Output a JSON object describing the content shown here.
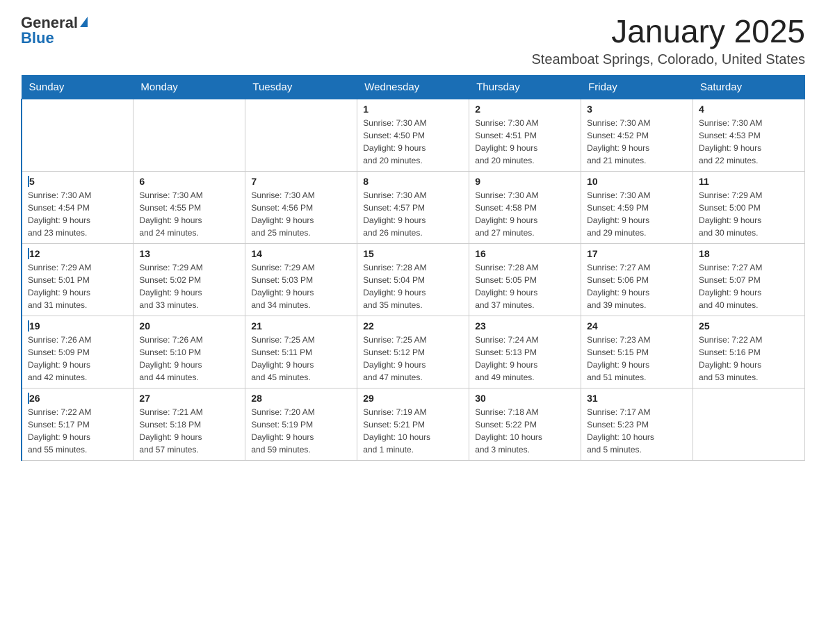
{
  "header": {
    "logo_general": "General",
    "logo_blue": "Blue",
    "month_year": "January 2025",
    "location": "Steamboat Springs, Colorado, United States"
  },
  "days_of_week": [
    "Sunday",
    "Monday",
    "Tuesday",
    "Wednesday",
    "Thursday",
    "Friday",
    "Saturday"
  ],
  "weeks": [
    [
      {
        "num": "",
        "info": ""
      },
      {
        "num": "",
        "info": ""
      },
      {
        "num": "",
        "info": ""
      },
      {
        "num": "1",
        "info": "Sunrise: 7:30 AM\nSunset: 4:50 PM\nDaylight: 9 hours\nand 20 minutes."
      },
      {
        "num": "2",
        "info": "Sunrise: 7:30 AM\nSunset: 4:51 PM\nDaylight: 9 hours\nand 20 minutes."
      },
      {
        "num": "3",
        "info": "Sunrise: 7:30 AM\nSunset: 4:52 PM\nDaylight: 9 hours\nand 21 minutes."
      },
      {
        "num": "4",
        "info": "Sunrise: 7:30 AM\nSunset: 4:53 PM\nDaylight: 9 hours\nand 22 minutes."
      }
    ],
    [
      {
        "num": "5",
        "info": "Sunrise: 7:30 AM\nSunset: 4:54 PM\nDaylight: 9 hours\nand 23 minutes."
      },
      {
        "num": "6",
        "info": "Sunrise: 7:30 AM\nSunset: 4:55 PM\nDaylight: 9 hours\nand 24 minutes."
      },
      {
        "num": "7",
        "info": "Sunrise: 7:30 AM\nSunset: 4:56 PM\nDaylight: 9 hours\nand 25 minutes."
      },
      {
        "num": "8",
        "info": "Sunrise: 7:30 AM\nSunset: 4:57 PM\nDaylight: 9 hours\nand 26 minutes."
      },
      {
        "num": "9",
        "info": "Sunrise: 7:30 AM\nSunset: 4:58 PM\nDaylight: 9 hours\nand 27 minutes."
      },
      {
        "num": "10",
        "info": "Sunrise: 7:30 AM\nSunset: 4:59 PM\nDaylight: 9 hours\nand 29 minutes."
      },
      {
        "num": "11",
        "info": "Sunrise: 7:29 AM\nSunset: 5:00 PM\nDaylight: 9 hours\nand 30 minutes."
      }
    ],
    [
      {
        "num": "12",
        "info": "Sunrise: 7:29 AM\nSunset: 5:01 PM\nDaylight: 9 hours\nand 31 minutes."
      },
      {
        "num": "13",
        "info": "Sunrise: 7:29 AM\nSunset: 5:02 PM\nDaylight: 9 hours\nand 33 minutes."
      },
      {
        "num": "14",
        "info": "Sunrise: 7:29 AM\nSunset: 5:03 PM\nDaylight: 9 hours\nand 34 minutes."
      },
      {
        "num": "15",
        "info": "Sunrise: 7:28 AM\nSunset: 5:04 PM\nDaylight: 9 hours\nand 35 minutes."
      },
      {
        "num": "16",
        "info": "Sunrise: 7:28 AM\nSunset: 5:05 PM\nDaylight: 9 hours\nand 37 minutes."
      },
      {
        "num": "17",
        "info": "Sunrise: 7:27 AM\nSunset: 5:06 PM\nDaylight: 9 hours\nand 39 minutes."
      },
      {
        "num": "18",
        "info": "Sunrise: 7:27 AM\nSunset: 5:07 PM\nDaylight: 9 hours\nand 40 minutes."
      }
    ],
    [
      {
        "num": "19",
        "info": "Sunrise: 7:26 AM\nSunset: 5:09 PM\nDaylight: 9 hours\nand 42 minutes."
      },
      {
        "num": "20",
        "info": "Sunrise: 7:26 AM\nSunset: 5:10 PM\nDaylight: 9 hours\nand 44 minutes."
      },
      {
        "num": "21",
        "info": "Sunrise: 7:25 AM\nSunset: 5:11 PM\nDaylight: 9 hours\nand 45 minutes."
      },
      {
        "num": "22",
        "info": "Sunrise: 7:25 AM\nSunset: 5:12 PM\nDaylight: 9 hours\nand 47 minutes."
      },
      {
        "num": "23",
        "info": "Sunrise: 7:24 AM\nSunset: 5:13 PM\nDaylight: 9 hours\nand 49 minutes."
      },
      {
        "num": "24",
        "info": "Sunrise: 7:23 AM\nSunset: 5:15 PM\nDaylight: 9 hours\nand 51 minutes."
      },
      {
        "num": "25",
        "info": "Sunrise: 7:22 AM\nSunset: 5:16 PM\nDaylight: 9 hours\nand 53 minutes."
      }
    ],
    [
      {
        "num": "26",
        "info": "Sunrise: 7:22 AM\nSunset: 5:17 PM\nDaylight: 9 hours\nand 55 minutes."
      },
      {
        "num": "27",
        "info": "Sunrise: 7:21 AM\nSunset: 5:18 PM\nDaylight: 9 hours\nand 57 minutes."
      },
      {
        "num": "28",
        "info": "Sunrise: 7:20 AM\nSunset: 5:19 PM\nDaylight: 9 hours\nand 59 minutes."
      },
      {
        "num": "29",
        "info": "Sunrise: 7:19 AM\nSunset: 5:21 PM\nDaylight: 10 hours\nand 1 minute."
      },
      {
        "num": "30",
        "info": "Sunrise: 7:18 AM\nSunset: 5:22 PM\nDaylight: 10 hours\nand 3 minutes."
      },
      {
        "num": "31",
        "info": "Sunrise: 7:17 AM\nSunset: 5:23 PM\nDaylight: 10 hours\nand 5 minutes."
      },
      {
        "num": "",
        "info": ""
      }
    ]
  ]
}
